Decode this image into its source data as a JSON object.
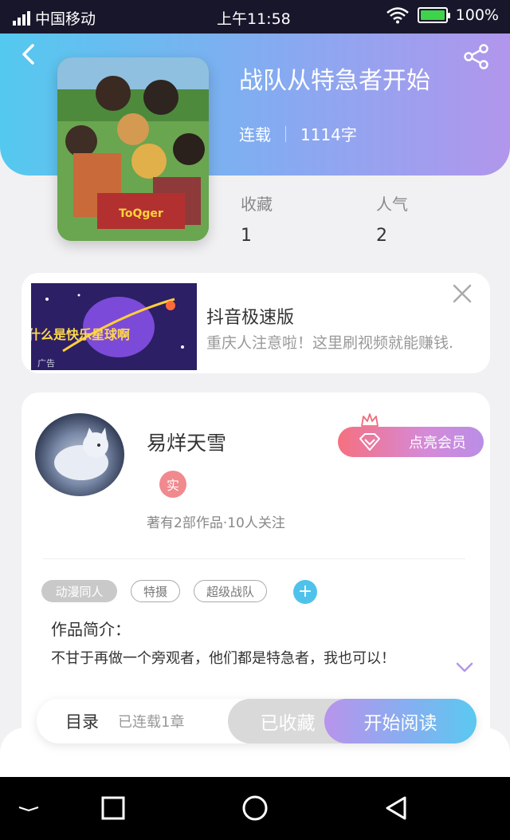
{
  "status_bar": {
    "carrier": "中国移动",
    "time": "上午11:58",
    "battery": "100%"
  },
  "book": {
    "title": "战队从特急者开始",
    "status": "连载",
    "word_count": "1114字",
    "stats": [
      {
        "label": "收藏",
        "value": "1"
      },
      {
        "label": "人气",
        "value": "2"
      }
    ]
  },
  "ad": {
    "title": "抖音极速版",
    "description": "重庆人注意啦！这里刷视频就能赚钱.",
    "image_text": "什么是快乐星球啊",
    "corner_label": "广告"
  },
  "author": {
    "name": "易烊天雪",
    "verify_badge": "实",
    "stats": "著有2部作品·10人关注",
    "vip_button": "点亮会员"
  },
  "tags": [
    "动漫同人",
    "特摄",
    "超级战队"
  ],
  "add_tag": "+",
  "intro": {
    "label": "作品简介：",
    "text": "不甘于再做一个旁观者，他们都是特急者，我也可以！"
  },
  "action_bar": {
    "toc": "目录",
    "chapters": "已连载1章",
    "collected": "已收藏",
    "read": "开始阅读"
  },
  "colors": {
    "header_start": "#54c9ef",
    "header_end": "#b196ec",
    "vip_start": "#f5707f",
    "tag_add": "#4fc2ec"
  }
}
